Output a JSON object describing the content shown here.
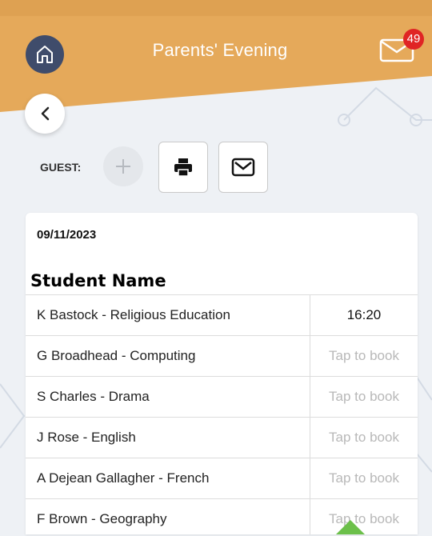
{
  "header": {
    "title": "Parents' Evening",
    "mail_badge": "49",
    "banner_color": "#e5a95a",
    "home_color": "#3f4c6b"
  },
  "guest": {
    "label": "GUEST:"
  },
  "toolbar": {
    "print_icon": "printer-icon",
    "email_icon": "envelope-icon"
  },
  "card": {
    "date": "09/11/2023",
    "column_heading": "Student Name",
    "rows": [
      {
        "teacher": "K Bastock - Religious Education",
        "slot": "16:20",
        "booked": true
      },
      {
        "teacher": "G Broadhead - Computing",
        "slot": "Tap to book",
        "booked": false
      },
      {
        "teacher": "S Charles - Drama",
        "slot": "Tap to book",
        "booked": false
      },
      {
        "teacher": "J Rose - English",
        "slot": "Tap to book",
        "booked": false
      },
      {
        "teacher": "A Dejean Gallagher - French",
        "slot": "Tap to book",
        "booked": false
      },
      {
        "teacher": "F Brown - Geography",
        "slot": "Tap to book",
        "booked": false
      }
    ]
  }
}
